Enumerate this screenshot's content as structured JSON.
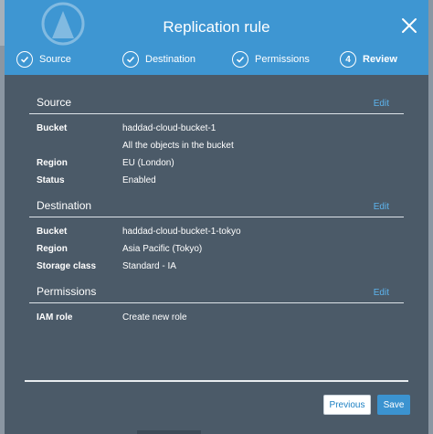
{
  "modal": {
    "title": "Replication rule"
  },
  "steps": [
    {
      "label": "Source",
      "done": true
    },
    {
      "label": "Destination",
      "done": true
    },
    {
      "label": "Permissions",
      "done": true
    },
    {
      "label": "Review",
      "number": "4",
      "active": true
    }
  ],
  "sections": {
    "source": {
      "title": "Source",
      "edit": "Edit",
      "rows": [
        {
          "key": "Bucket",
          "value": "haddad-cloud-bucket-1"
        },
        {
          "key": "",
          "value": "All the objects in the bucket"
        },
        {
          "key": "Region",
          "value": "EU (London)"
        },
        {
          "key": "Status",
          "value": "Enabled"
        }
      ]
    },
    "destination": {
      "title": "Destination",
      "edit": "Edit",
      "rows": [
        {
          "key": "Bucket",
          "value": "haddad-cloud-bucket-1-tokyo"
        },
        {
          "key": "Region",
          "value": "Asia Pacific (Tokyo)"
        },
        {
          "key": "Storage class",
          "value": "Standard - IA"
        }
      ]
    },
    "permissions": {
      "title": "Permissions",
      "edit": "Edit",
      "rows": [
        {
          "key": "IAM role",
          "value": "Create new role"
        }
      ]
    }
  },
  "buttons": {
    "previous": "Previous",
    "save": "Save"
  },
  "colors": {
    "header": "#3e96d2",
    "modal_bg": "#4b5a68",
    "link": "#5db4ee",
    "primary_button": "#3b93d0"
  }
}
